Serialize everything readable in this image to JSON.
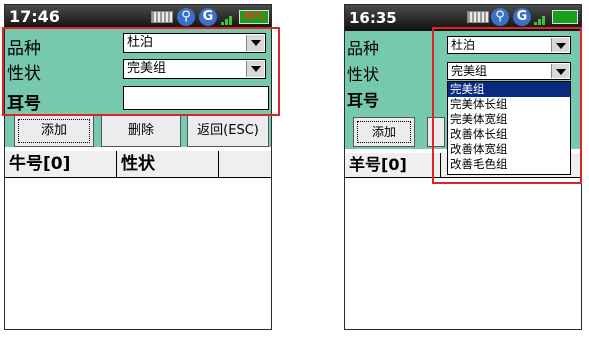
{
  "left": {
    "status": {
      "time": "17:46",
      "battery": "86%"
    },
    "form": {
      "breed_label": "品种",
      "breed_value": "杜泊",
      "trait_label": "性状",
      "trait_value": "完美组",
      "ear_label": "耳号",
      "ear_value": ""
    },
    "buttons": {
      "add": "添加",
      "delete": "删除",
      "back": "返回(ESC)"
    },
    "table": {
      "col1": "牛号[0]",
      "col2": "性状",
      "col3": ""
    }
  },
  "right": {
    "status": {
      "time": "16:35"
    },
    "form": {
      "breed_label": "品种",
      "breed_value": "杜泊",
      "trait_label": "性状",
      "trait_value": "完美组",
      "ear_label": "耳号"
    },
    "buttons": {
      "add": "添加"
    },
    "table": {
      "col1": "羊号[0]"
    },
    "dropdown_options": [
      "完美组",
      "完美体长组",
      "完美体宽组",
      "改善体长组",
      "改善体宽组",
      "改善毛色组"
    ],
    "dropdown_selected_index": 0
  },
  "colors": {
    "form_bg": "#76c8ae",
    "highlight_border": "#e02424",
    "selected_option": "#0a2a80"
  }
}
